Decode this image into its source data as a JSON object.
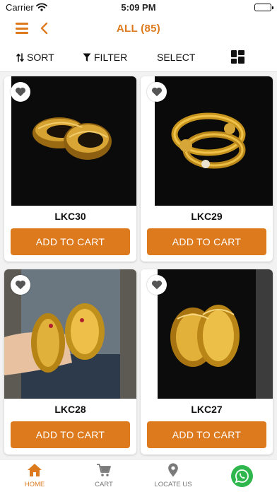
{
  "status_bar": {
    "carrier": "Carrier",
    "time": "5:09 PM"
  },
  "header": {
    "title": "ALL (85)",
    "menu_icon": "hamburger-menu-icon",
    "back_icon": "chevron-left-icon"
  },
  "toolbar": {
    "sort_label": "SORT",
    "filter_label": "FILTER",
    "select_label": "SELECT",
    "view_icon": "grid-view-icon"
  },
  "products": [
    {
      "code": "LKC30",
      "button_label": "ADD TO CART"
    },
    {
      "code": "LKC29",
      "button_label": "ADD TO CART"
    },
    {
      "code": "LKC28",
      "button_label": "ADD TO CART"
    },
    {
      "code": "LKC27",
      "button_label": "ADD TO CART"
    }
  ],
  "tabs": [
    {
      "label": "HOME",
      "icon": "home-icon",
      "active": true
    },
    {
      "label": "CART",
      "icon": "cart-icon",
      "active": false
    },
    {
      "label": "LOCATE US",
      "icon": "location-pin-icon",
      "active": false
    }
  ],
  "whatsapp": {
    "icon": "whatsapp-icon"
  },
  "colors": {
    "accent": "#de7a1e",
    "whatsapp": "#2fb64c",
    "background": "#f2f2f2"
  }
}
